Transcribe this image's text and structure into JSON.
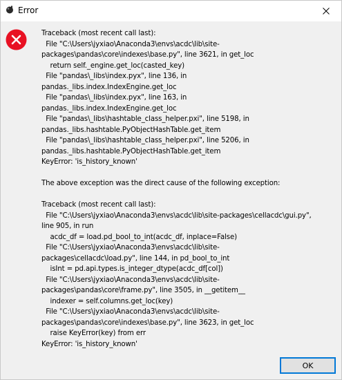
{
  "window": {
    "title": "Error"
  },
  "dialog": {
    "icon": "error-icon",
    "message": "Traceback (most recent call last):\n  File \"C:\\Users\\jyxiao\\Anaconda3\\envs\\acdc\\lib\\site-\npackages\\pandas\\core\\indexes\\base.py\", line 3621, in get_loc\n    return self._engine.get_loc(casted_key)\n  File \"pandas\\_libs\\index.pyx\", line 136, in\npandas._libs.index.IndexEngine.get_loc\n  File \"pandas\\_libs\\index.pyx\", line 163, in\npandas._libs.index.IndexEngine.get_loc\n  File \"pandas\\_libs\\hashtable_class_helper.pxi\", line 5198, in\npandas._libs.hashtable.PyObjectHashTable.get_item\n  File \"pandas\\_libs\\hashtable_class_helper.pxi\", line 5206, in\npandas._libs.hashtable.PyObjectHashTable.get_item\nKeyError: 'is_history_known'\n\nThe above exception was the direct cause of the following exception:\n\nTraceback (most recent call last):\n  File \"C:\\Users\\jyxiao\\Anaconda3\\envs\\acdc\\lib\\site-packages\\cellacdc\\gui.py\",\nline 905, in run\n    acdc_df = load.pd_bool_to_int(acdc_df, inplace=False)\n  File \"C:\\Users\\jyxiao\\Anaconda3\\envs\\acdc\\lib\\site-\npackages\\cellacdc\\load.py\", line 144, in pd_bool_to_int\n    isInt = pd.api.types.is_integer_dtype(acdc_df[col])\n  File \"C:\\Users\\jyxiao\\Anaconda3\\envs\\acdc\\lib\\site-\npackages\\pandas\\core\\frame.py\", line 3505, in __getitem__\n    indexer = self.columns.get_loc(key)\n  File \"C:\\Users\\jyxiao\\Anaconda3\\envs\\acdc\\lib\\site-\npackages\\pandas\\core\\indexes\\base.py\", line 3623, in get_loc\n    raise KeyError(key) from err\nKeyError: 'is_history_known'",
    "ok_label": "OK"
  },
  "colors": {
    "error_red": "#e81123",
    "accent": "#0078d7",
    "dialog_bg": "#f0f0f0"
  }
}
